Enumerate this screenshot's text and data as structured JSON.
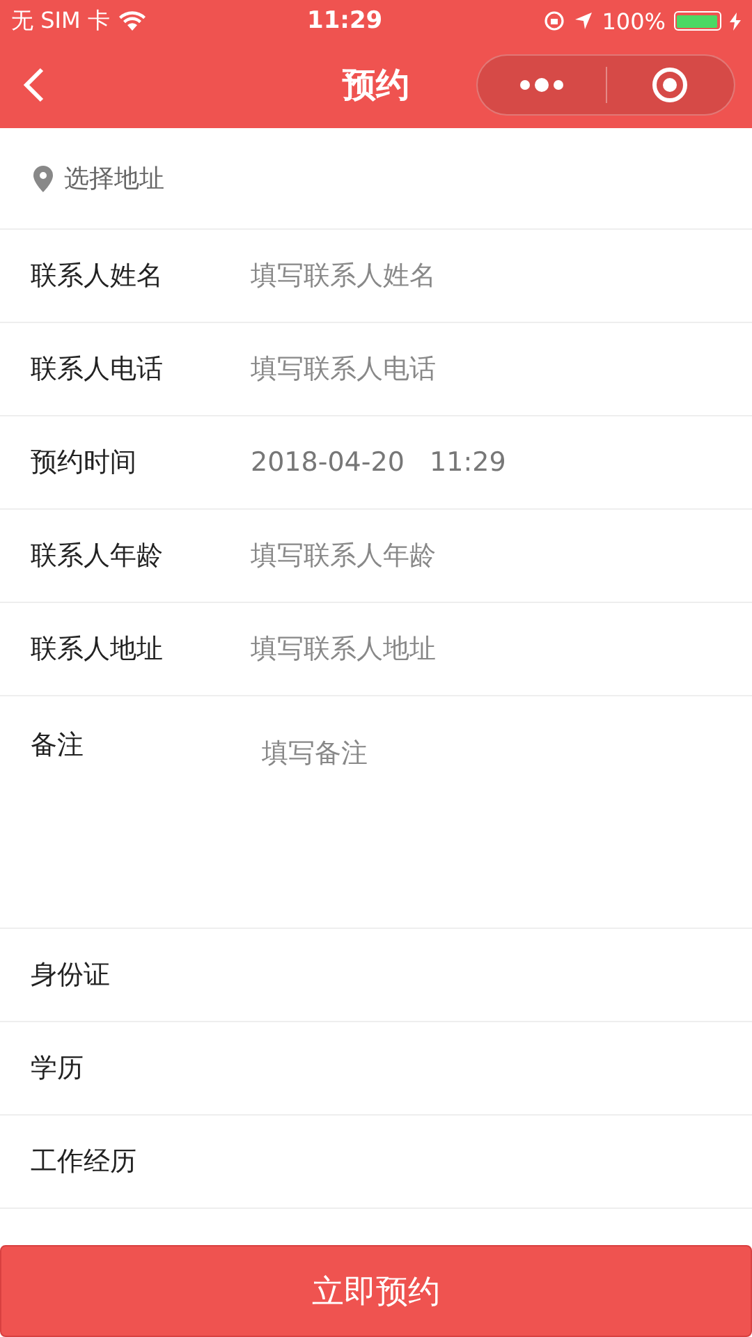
{
  "status_bar": {
    "carrier": "无 SIM 卡",
    "time": "11:29",
    "battery": "100%"
  },
  "nav": {
    "title": "预约"
  },
  "address": {
    "label": "选择地址"
  },
  "fields": [
    {
      "kind": "input",
      "label": "联系人姓名",
      "placeholder": "填写联系人姓名"
    },
    {
      "kind": "input",
      "label": "联系人电话",
      "placeholder": "填写联系人电话"
    },
    {
      "kind": "picker",
      "label": "预约时间",
      "value": "2018-04-20   11:29"
    },
    {
      "kind": "input",
      "label": "联系人年龄",
      "placeholder": "填写联系人年龄"
    },
    {
      "kind": "input",
      "label": "联系人地址",
      "placeholder": "填写联系人地址"
    },
    {
      "kind": "textarea",
      "label": "备注",
      "placeholder": "填写备注"
    },
    {
      "kind": "plain",
      "label": "身份证"
    },
    {
      "kind": "plain",
      "label": "学历"
    },
    {
      "kind": "plain",
      "label": "工作经历"
    }
  ],
  "submit": {
    "label": "立即预约"
  }
}
